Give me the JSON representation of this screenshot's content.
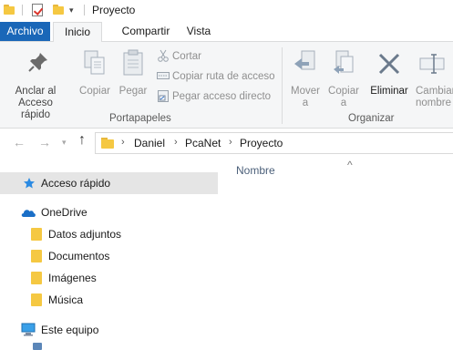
{
  "window": {
    "title": "Proyecto"
  },
  "quick_access": {
    "dropdown_glyph": "▾"
  },
  "tabs": {
    "file": "Archivo",
    "home": "Inicio",
    "share": "Compartir",
    "view": "Vista"
  },
  "ribbon": {
    "pin_label": "Anclar al\nAcceso rápido",
    "copy_label": "Copiar",
    "paste_label": "Pegar",
    "cut_label": "Cortar",
    "copy_path_label": "Copiar ruta de acceso",
    "paste_shortcut_label": "Pegar acceso directo",
    "clipboard_group": "Portapapeles",
    "move_to_label": "Mover\na",
    "copy_to_label": "Copiar\na",
    "delete_label": "Eliminar",
    "rename_label": "Cambiar\nnombre",
    "organize_group": "Organizar"
  },
  "address": {
    "crumbs": [
      "Daniel",
      "PcaNet",
      "Proyecto"
    ]
  },
  "nav_pane": {
    "quick_access": "Acceso rápido",
    "onedrive": "OneDrive",
    "onedrive_items": [
      "Datos adjuntos",
      "Documentos",
      "Imágenes",
      "Música"
    ],
    "this_pc": "Este equipo"
  },
  "content": {
    "name_column": "Nombre"
  },
  "colors": {
    "accent": "#1a67b8",
    "selection": "#cce8ff",
    "folder": "#f5c842"
  }
}
